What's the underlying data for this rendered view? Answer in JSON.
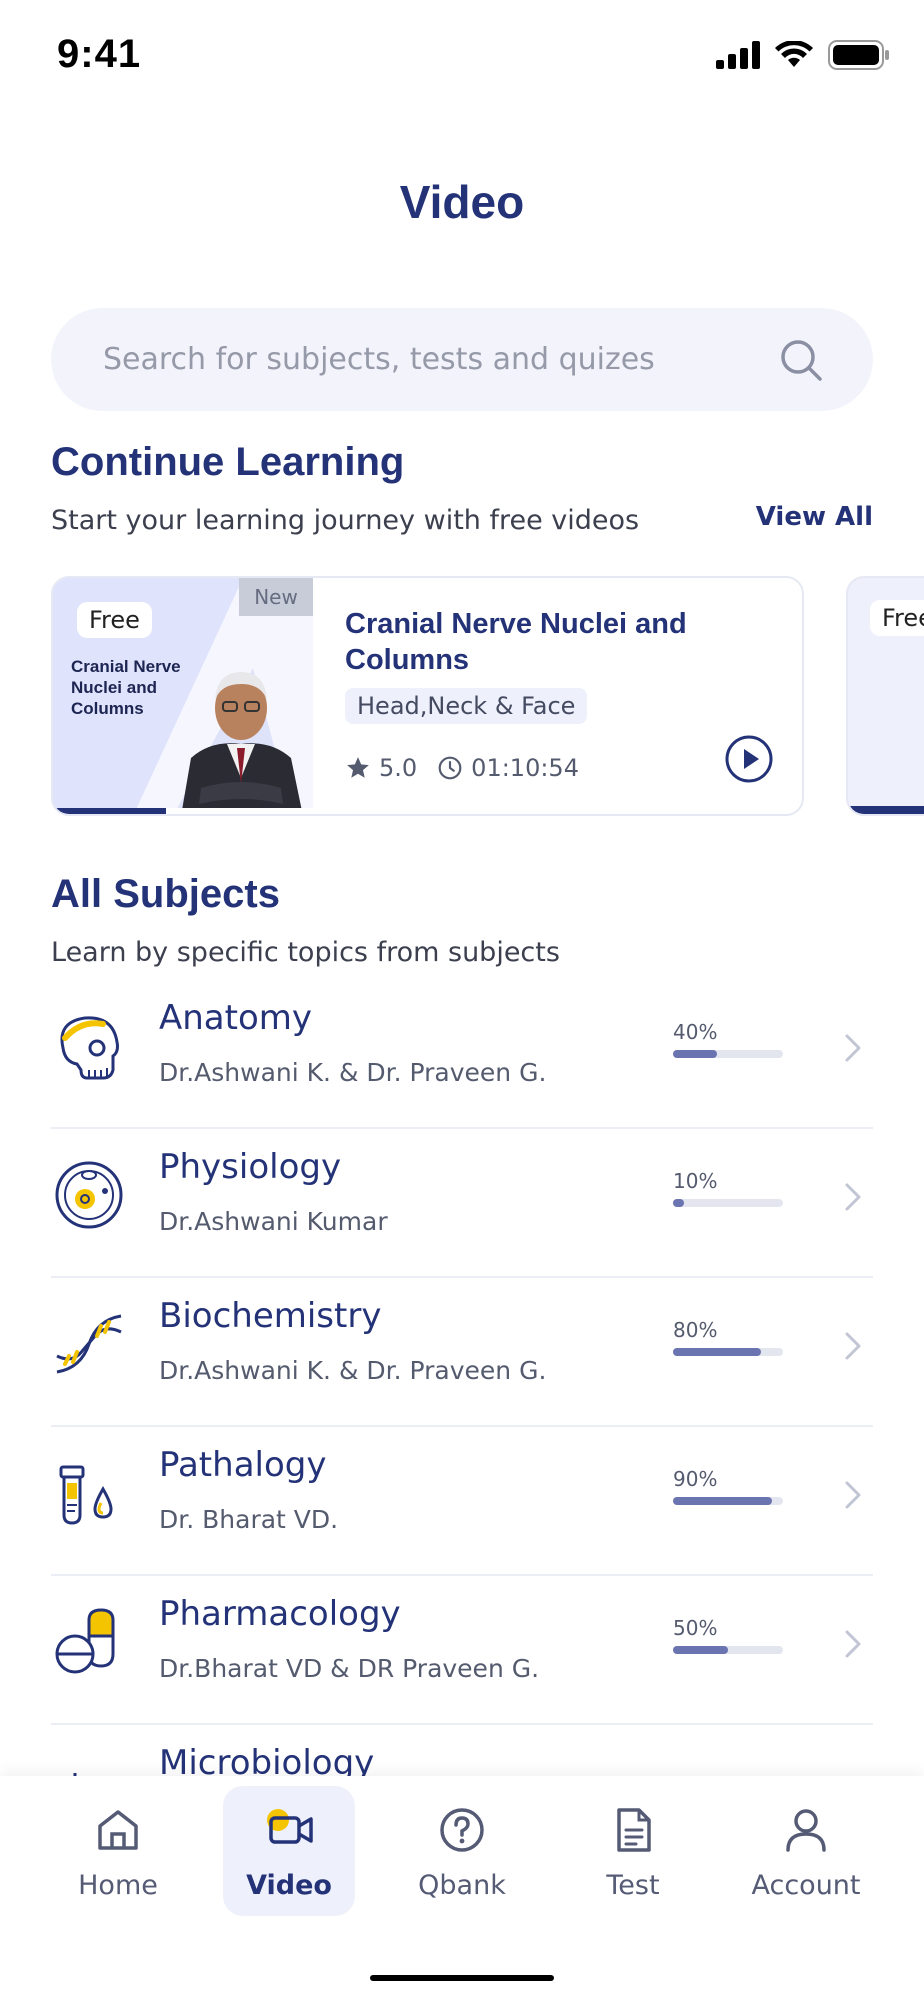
{
  "status_bar": {
    "time": "9:41"
  },
  "header": {
    "title": "Video"
  },
  "search": {
    "placeholder": "Search for subjects, tests and quizes"
  },
  "continue_learning": {
    "title": "Continue Learning",
    "subtitle": "Start your learning journey with free videos",
    "view_all": "View All",
    "cards": [
      {
        "badge": "Free",
        "new_label": "New",
        "thumb_text": "Cranial Nerve Nuclei and Columns",
        "title": "Cranial Nerve Nuclei and Columns",
        "tag": "Head,Neck & Face",
        "rating": "5.0",
        "duration": "01:10:54",
        "progress_percent": 15
      },
      {
        "badge": "Free"
      }
    ]
  },
  "all_subjects": {
    "title": "All Subjects",
    "subtitle": "Learn by specific topics from subjects",
    "items": [
      {
        "name": "Anatomy",
        "author": "Dr.Ashwani K. & Dr. Praveen G.",
        "progress": "40%",
        "progress_value": 40,
        "icon": "skull-icon"
      },
      {
        "name": "Physiology",
        "author": "Dr.Ashwani Kumar",
        "progress": "10%",
        "progress_value": 10,
        "icon": "cell-icon"
      },
      {
        "name": "Biochemistry",
        "author": "Dr.Ashwani K. & Dr. Praveen G.",
        "progress": "80%",
        "progress_value": 80,
        "icon": "dna-icon"
      },
      {
        "name": "Pathalogy",
        "author": "Dr. Bharat VD.",
        "progress": "90%",
        "progress_value": 90,
        "icon": "test-tube-icon"
      },
      {
        "name": "Pharmacology",
        "author": "Dr.Bharat VD & DR Praveen G.",
        "progress": "50%",
        "progress_value": 50,
        "icon": "pill-icon"
      },
      {
        "name": "Microbiology",
        "icon": "microbe-icon"
      }
    ]
  },
  "tab_bar": {
    "active": "Video",
    "tabs": [
      {
        "label": "Home",
        "icon": "home-icon"
      },
      {
        "label": "Video",
        "icon": "video-icon"
      },
      {
        "label": "Qbank",
        "icon": "question-icon"
      },
      {
        "label": "Test",
        "icon": "document-icon"
      },
      {
        "label": "Account",
        "icon": "user-icon"
      }
    ]
  },
  "colors": {
    "primary": "#243278",
    "accent": "#f5c400",
    "progress": "#6a74b0"
  }
}
